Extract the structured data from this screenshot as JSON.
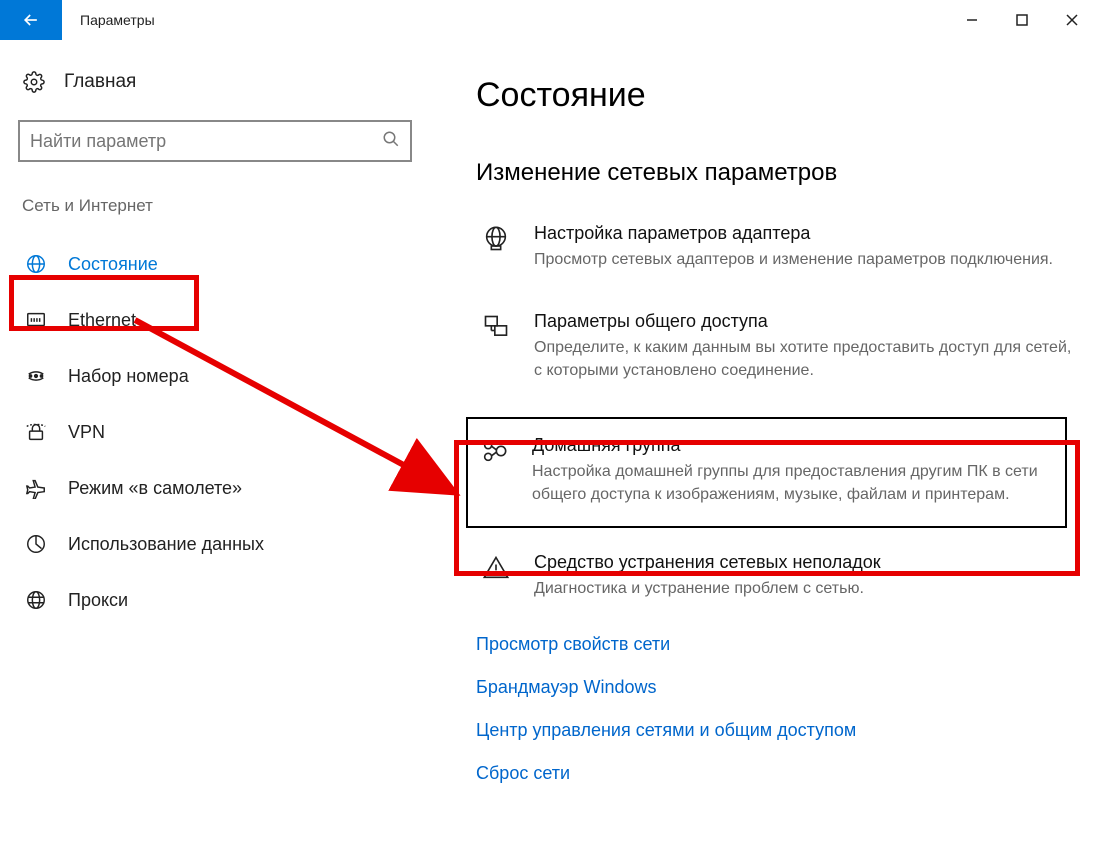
{
  "window": {
    "title": "Параметры"
  },
  "sidebar": {
    "home": "Главная",
    "search_placeholder": "Найти параметр",
    "section": "Сеть и Интернет",
    "items": [
      {
        "label": "Состояние",
        "icon": "globe"
      },
      {
        "label": "Ethernet",
        "icon": "ethernet"
      },
      {
        "label": "Набор номера",
        "icon": "dialup"
      },
      {
        "label": "VPN",
        "icon": "vpn"
      },
      {
        "label": "Режим «в самолете»",
        "icon": "airplane"
      },
      {
        "label": "Использование данных",
        "icon": "data"
      },
      {
        "label": "Прокси",
        "icon": "proxy"
      }
    ]
  },
  "main": {
    "title": "Состояние",
    "subhead": "Изменение сетевых параметров",
    "rows": [
      {
        "title": "Настройка параметров адаптера",
        "desc": "Просмотр сетевых адаптеров и изменение параметров подключения."
      },
      {
        "title": "Параметры общего доступа",
        "desc": "Определите, к каким данным вы хотите предоставить доступ для сетей, с которыми установлено соединение."
      },
      {
        "title": "Домашняя группа",
        "desc": "Настройка домашней группы для предоставления другим ПК в сети общего доступа к изображениям, музыке, файлам и принтерам."
      },
      {
        "title": "Средство устранения сетевых неполадок",
        "desc": "Диагностика и устранение проблем с сетью."
      }
    ],
    "links": [
      "Просмотр свойств сети",
      "Брандмауэр Windows",
      "Центр управления сетями и общим доступом",
      "Сброс сети"
    ]
  }
}
